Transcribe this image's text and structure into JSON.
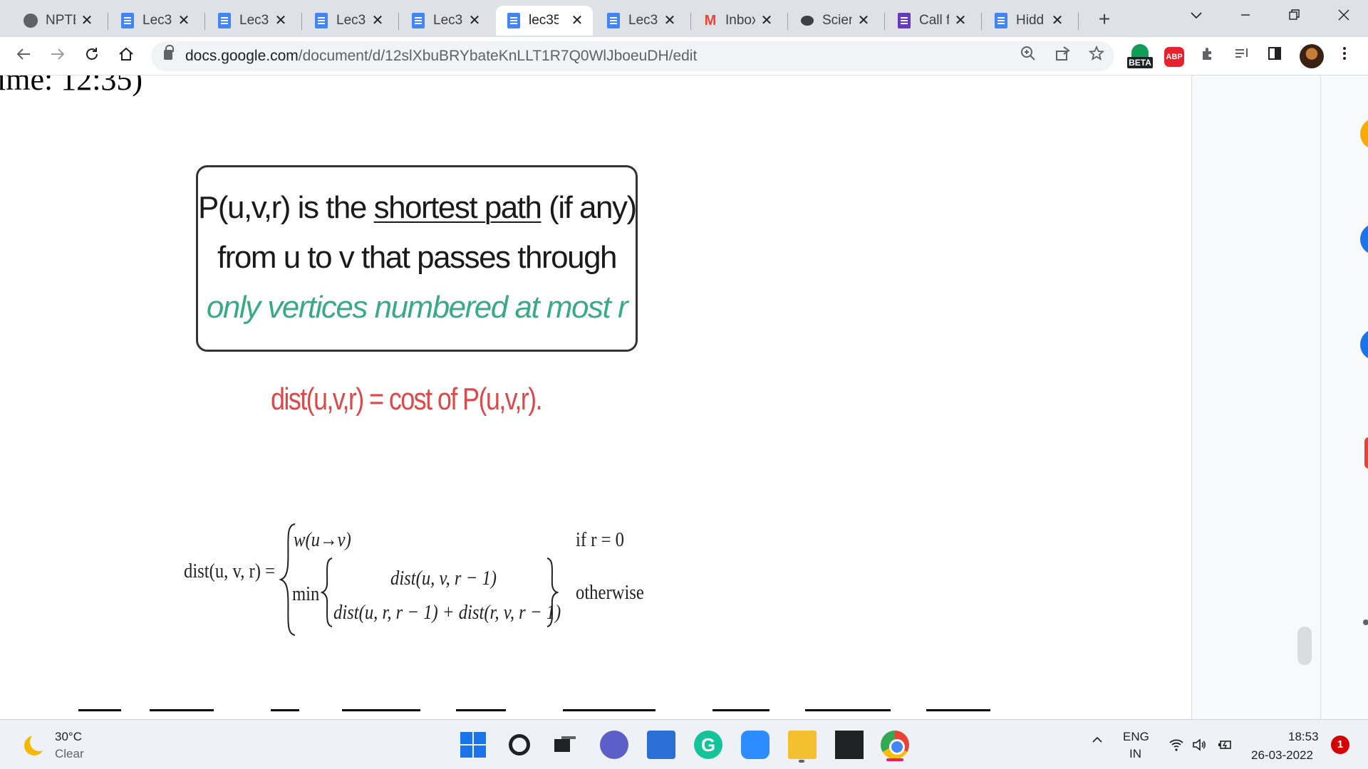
{
  "browser": {
    "tabs": [
      {
        "title": "NPTE",
        "icon": "globe-icon",
        "active": false
      },
      {
        "title": "Lec3",
        "icon": "google-docs-icon",
        "active": false
      },
      {
        "title": "Lec3",
        "icon": "google-docs-icon",
        "active": false
      },
      {
        "title": "Lec3",
        "icon": "google-docs-icon",
        "active": false
      },
      {
        "title": "Lec3",
        "icon": "google-docs-icon",
        "active": false
      },
      {
        "title": "lec35",
        "icon": "google-docs-icon",
        "active": true
      },
      {
        "title": "Lec3",
        "icon": "google-docs-icon",
        "active": false
      },
      {
        "title": "Inbox",
        "icon": "gmail-icon",
        "active": false
      },
      {
        "title": "Scien",
        "icon": "chat-icon",
        "active": false
      },
      {
        "title": "Call f",
        "icon": "google-forms-icon",
        "active": false
      },
      {
        "title": "Hidd",
        "icon": "google-docs-icon",
        "active": false
      }
    ],
    "close_glyph": "✕",
    "new_tab_glyph": "+",
    "url_host": "docs.google.com",
    "url_path": "/document/d/12slXbuBRYbateKnLLT1R7Q0WlJboeuDH/edit",
    "extensions": {
      "beta_badge": "BETA",
      "abp_label": "ABP"
    }
  },
  "document": {
    "top_fragment": "ime: 12:35)",
    "definition_box": {
      "line1_prefix": "P(u,v,r) is the ",
      "line1_underlined": "shortest path",
      "line1_suffix": " (if any)",
      "line2": "from u to v that passes through",
      "line3": "only vertices numbered at most r"
    },
    "dist_cost": "dist(u,v,r) = cost of P(u,v,r).",
    "recurrence": {
      "lhs": "dist(u, v, r) =",
      "case1_expr": "w(u→v)",
      "case1_cond": "if r = 0",
      "min_label": "min",
      "min_option1": "dist(u, v, r − 1)",
      "min_option2": "dist(u, r, r − 1) + dist(r, v, r − 1)",
      "case2_cond": "otherwise"
    },
    "colors": {
      "definition_green": "#3aaa86",
      "dist_red": "#d94a4a"
    }
  },
  "taskbar": {
    "weather_temp": "30°C",
    "weather_cond": "Clear",
    "lang_line1": "ENG",
    "lang_line2": "IN",
    "time": "18:53",
    "date": "26-03-2022",
    "notification_count": "1"
  }
}
